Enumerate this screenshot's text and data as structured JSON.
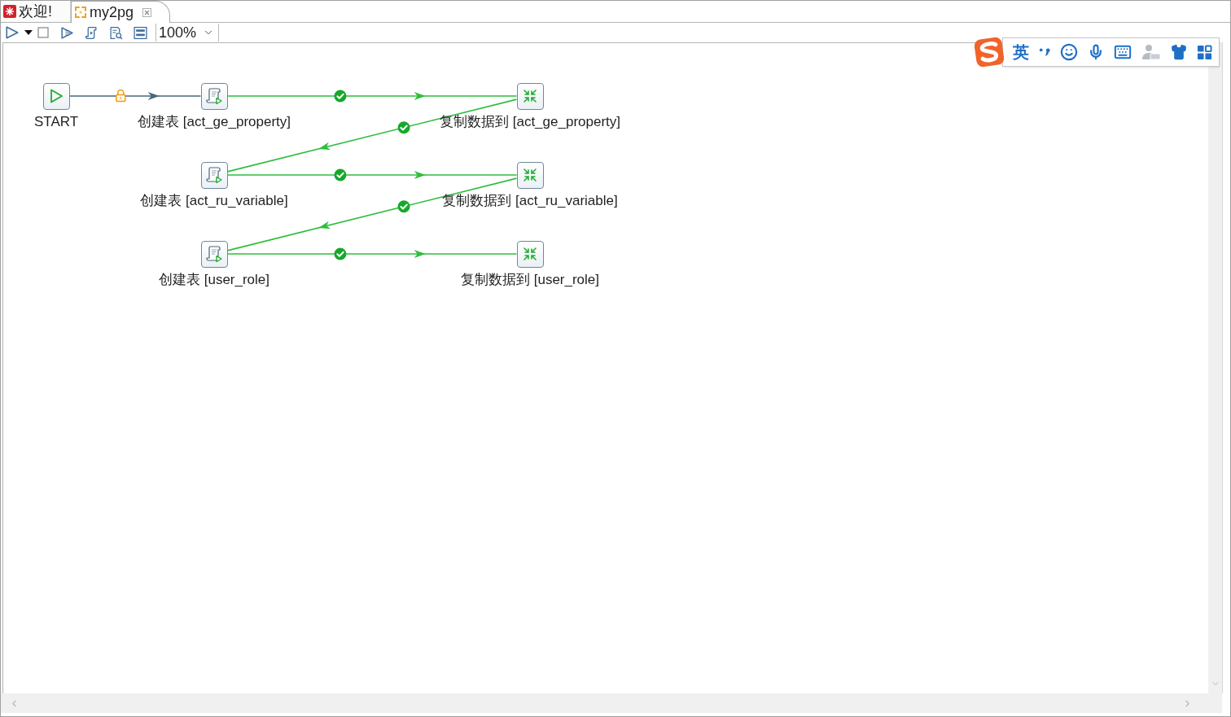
{
  "tabs": [
    {
      "label": "欢迎!",
      "kind": "welcome",
      "selected": false,
      "closable": false
    },
    {
      "label": "my2pg",
      "kind": "job",
      "selected": true,
      "closable": true
    }
  ],
  "toolbar": {
    "zoom": "100%"
  },
  "canvas": {
    "nodes": [
      {
        "kind": "start",
        "label": "START"
      },
      {
        "kind": "sql",
        "label": "创建表 [act_ge_property]"
      },
      {
        "kind": "copy",
        "label": "复制数据到 [act_ge_property]"
      },
      {
        "kind": "sql",
        "label": "创建表 [act_ru_variable]"
      },
      {
        "kind": "copy",
        "label": "复制数据到 [act_ru_variable]"
      },
      {
        "kind": "sql",
        "label": "创建表 [user_role]"
      },
      {
        "kind": "copy",
        "label": "复制数据到 [user_role]"
      }
    ],
    "hops": [
      {
        "kind": "locked"
      },
      {
        "kind": "ok"
      },
      {
        "kind": "ok"
      },
      {
        "kind": "ok"
      },
      {
        "kind": "ok"
      },
      {
        "kind": "ok"
      }
    ]
  },
  "ime_toolbar": {
    "mode": "英"
  }
}
